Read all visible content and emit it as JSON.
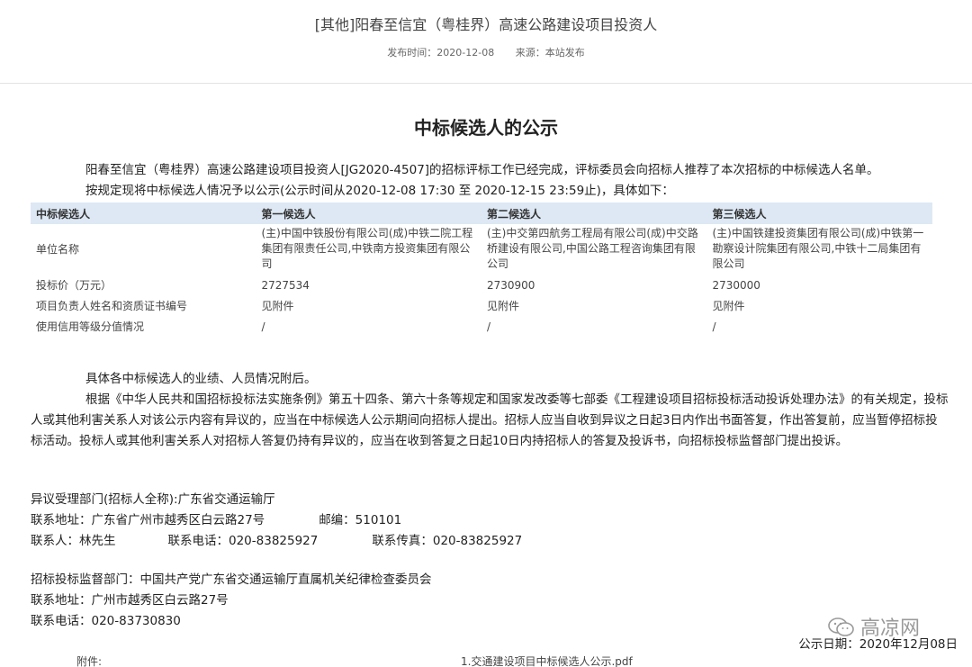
{
  "header": {
    "title": "[其他]阳春至信宜（粤桂界）高速公路建设项目投资人",
    "publish_time": "发布时间：2020-12-08",
    "source": "来源：本站发布"
  },
  "notice": {
    "title": "中标候选人的公示",
    "intro_line1": "阳春至信宜（粤桂界）高速公路建设项目投资人[JG2020-4507]的招标评标工作已经完成，评标委员会向招标人推荐了本次招标的中标候选人名单。",
    "intro_line2": "按规定现将中标候选人情况予以公示(公示时间从2020-12-08 17:30 至 2020-12-15 23:59止)，具体如下："
  },
  "table": {
    "headers": [
      "中标候选人",
      "第一候选人",
      "第二候选人",
      "第三候选人"
    ],
    "rows": [
      {
        "label": "单位名称",
        "values": [
          "(主)中国中铁股份有限公司(成)中铁二院工程集团有限责任公司,中铁南方投资集团有限公司",
          "(主)中交第四航务工程局有限公司(成)中交路桥建设有限公司,中国公路工程咨询集团有限公司",
          "(主)中国铁建投资集团有限公司(成)中铁第一勘察设计院集团有限公司,中铁十二局集团有限公司"
        ]
      },
      {
        "label": "投标价（万元）",
        "values": [
          "2727534",
          "2730900",
          "2730000"
        ]
      },
      {
        "label": "项目负责人姓名和资质证书编号",
        "values": [
          "见附件",
          "见附件",
          "见附件"
        ]
      },
      {
        "label": "使用信用等级分值情况",
        "values": [
          "/",
          "/",
          "/"
        ]
      }
    ]
  },
  "body": {
    "attachment_note": "具体各中标候选人的业绩、人员情况附后。",
    "law_paragraph": "根据《中华人民共和国招标投标法实施条例》第五十四条、第六十条等规定和国家发改委等七部委《工程建设项目招标投标活动投诉处理办法》的有关规定，投标人或其他利害关系人对该公示内容有异议的，应当在中标候选人公示期间向招标人提出。招标人应当自收到异议之日起3日内作出书面答复，作出答复前，应当暂停招标投标活动。投标人或其他利害关系人对招标人答复仍持有异议的，应当在收到答复之日起10日内持招标人的答复及投诉书，向招标投标监督部门提出投诉。"
  },
  "contact_objection": {
    "department": "异议受理部门(招标人全称):广东省交通运输厅",
    "address": "联系地址：广东省广州市越秀区白云路27号",
    "postcode": "邮编：510101",
    "person": "联系人：林先生",
    "phone": "联系电话：020-83825927",
    "fax": "联系传真：020-83825927"
  },
  "contact_supervision": {
    "department": "招标投标监督部门：中国共产党广东省交通运输厅直属机关纪律检查委员会",
    "address": "联系地址：广州市越秀区白云路27号",
    "phone": "联系电话：020-83730830"
  },
  "watermark": {
    "text": "高凉网",
    "icon": "wechat-icon"
  },
  "footer": {
    "date": "公示日期：2020年12月08日",
    "attachment_label": "附件:",
    "attachment_file": "1.交通建设项目中标候选人公示.pdf"
  }
}
